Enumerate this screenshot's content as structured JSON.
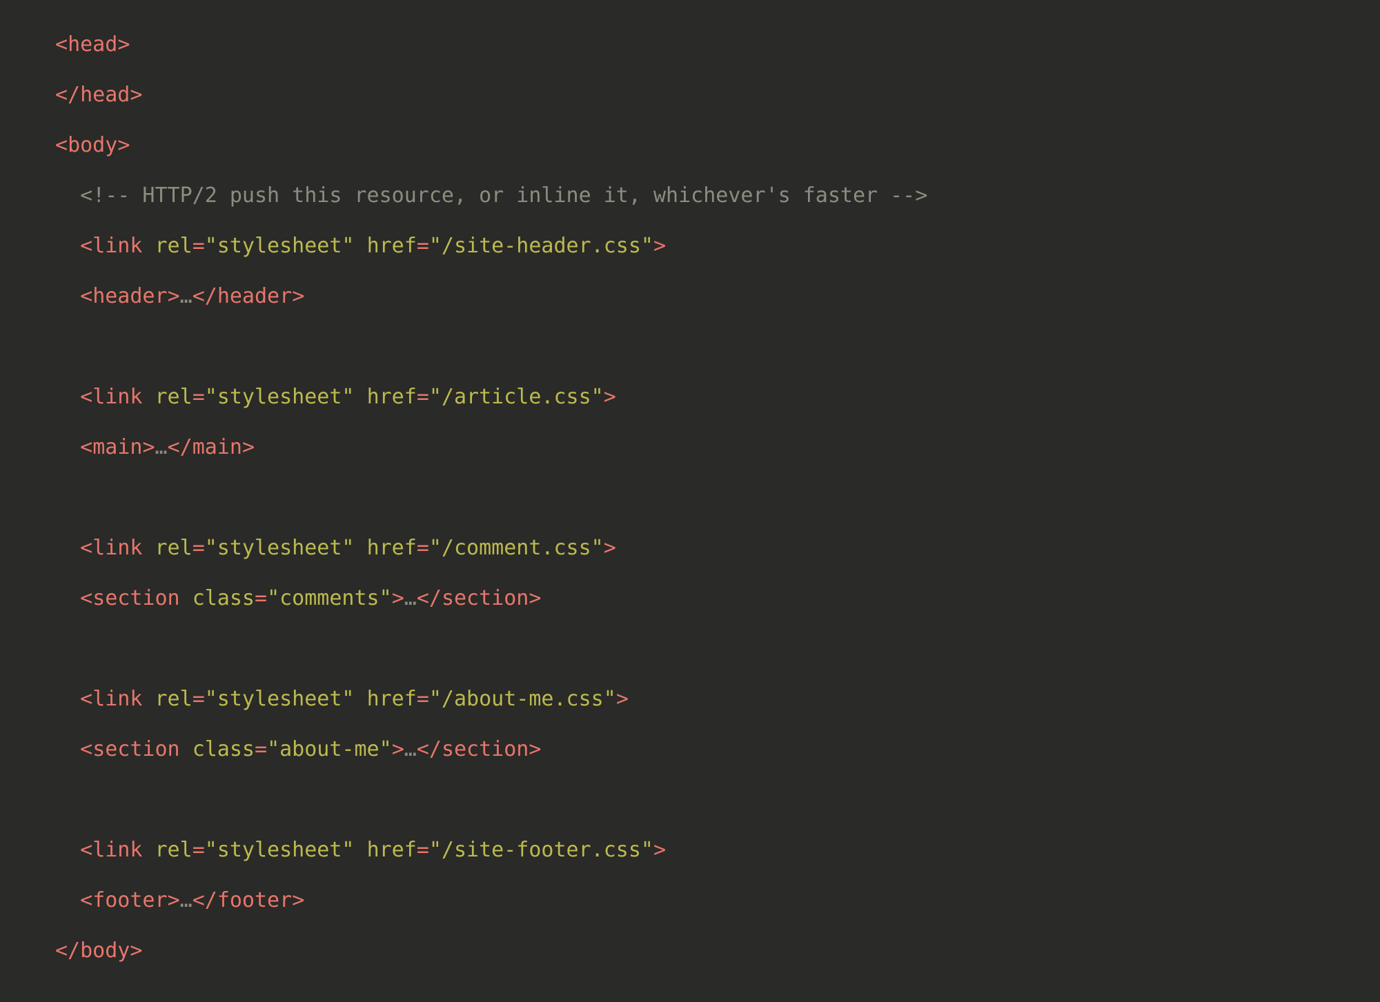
{
  "colors": {
    "background": "#2a2a28",
    "tag": "#e7766b",
    "attr": "#bcba4e",
    "string": "#bcba4e",
    "comment": "#8d8c80",
    "ellipsis": "#8d8c80"
  },
  "indent_unit": "  ",
  "lines": [
    {
      "kind": "tag_open",
      "indent": 0,
      "tag": "head"
    },
    {
      "kind": "tag_close",
      "indent": 0,
      "tag": "head"
    },
    {
      "kind": "tag_open",
      "indent": 0,
      "tag": "body"
    },
    {
      "kind": "comment",
      "indent": 1,
      "text": "HTTP/2 push this resource, or inline it, whichever's faster"
    },
    {
      "kind": "void_tag",
      "indent": 1,
      "tag": "link",
      "attrs": [
        [
          "rel",
          "stylesheet"
        ],
        [
          "href",
          "/site-header.css"
        ]
      ]
    },
    {
      "kind": "inline_pair",
      "indent": 1,
      "tag": "header",
      "attrs": [],
      "inner_ellipsis": true
    },
    {
      "kind": "blank"
    },
    {
      "kind": "void_tag",
      "indent": 1,
      "tag": "link",
      "attrs": [
        [
          "rel",
          "stylesheet"
        ],
        [
          "href",
          "/article.css"
        ]
      ]
    },
    {
      "kind": "inline_pair",
      "indent": 1,
      "tag": "main",
      "attrs": [],
      "inner_ellipsis": true
    },
    {
      "kind": "blank"
    },
    {
      "kind": "void_tag",
      "indent": 1,
      "tag": "link",
      "attrs": [
        [
          "rel",
          "stylesheet"
        ],
        [
          "href",
          "/comment.css"
        ]
      ]
    },
    {
      "kind": "inline_pair",
      "indent": 1,
      "tag": "section",
      "attrs": [
        [
          "class",
          "comments"
        ]
      ],
      "inner_ellipsis": true
    },
    {
      "kind": "blank"
    },
    {
      "kind": "void_tag",
      "indent": 1,
      "tag": "link",
      "attrs": [
        [
          "rel",
          "stylesheet"
        ],
        [
          "href",
          "/about-me.css"
        ]
      ]
    },
    {
      "kind": "inline_pair",
      "indent": 1,
      "tag": "section",
      "attrs": [
        [
          "class",
          "about-me"
        ]
      ],
      "inner_ellipsis": true
    },
    {
      "kind": "blank"
    },
    {
      "kind": "void_tag",
      "indent": 1,
      "tag": "link",
      "attrs": [
        [
          "rel",
          "stylesheet"
        ],
        [
          "href",
          "/site-footer.css"
        ]
      ]
    },
    {
      "kind": "inline_pair",
      "indent": 1,
      "tag": "footer",
      "attrs": [],
      "inner_ellipsis": true
    },
    {
      "kind": "tag_close",
      "indent": 0,
      "tag": "body"
    }
  ]
}
